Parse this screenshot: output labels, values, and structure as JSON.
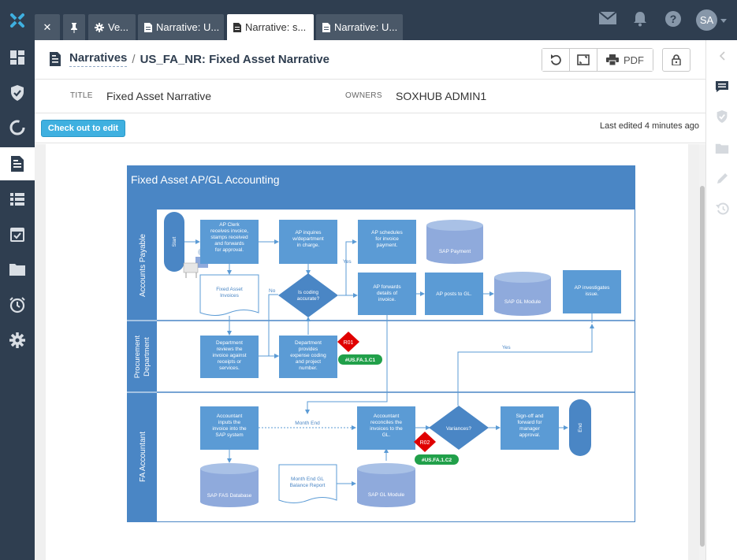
{
  "tabs": [
    {
      "label": "✕",
      "icon": "close-icon"
    },
    {
      "label": "",
      "icon": "pin-icon"
    },
    {
      "label": "Ve...",
      "icon": "gear-icon"
    },
    {
      "label": "Narrative: U...",
      "icon": "document-icon"
    },
    {
      "label": "Narrative: s...",
      "icon": "document-icon",
      "active": true
    },
    {
      "label": "Narrative: U...",
      "icon": "document-icon"
    }
  ],
  "user": {
    "initials": "SA"
  },
  "breadcrumb": {
    "root": "Narratives",
    "separator": "/",
    "current": "US_FA_NR: Fixed Asset Narrative"
  },
  "toolbar": {
    "pdf_label": "PDF"
  },
  "meta": {
    "title_label": "TITLE",
    "title_value": "Fixed Asset Narrative",
    "owners_label": "OWNERS",
    "owners_value": "SOXHUB ADMIN1"
  },
  "action": {
    "checkout_label": "Check out to edit",
    "last_edited": "Last edited 4 minutes ago"
  },
  "diagram": {
    "title": "Fixed Asset AP/GL Accounting",
    "lanes": [
      "Accounts Payable",
      "Procurement Department",
      "FA Accountant"
    ],
    "nodes": {
      "start": "Start",
      "ap_clerk": [
        "AP Clerk",
        "receives invoice,",
        "stamps received",
        "and forwards",
        "for approval."
      ],
      "ap_inquires": [
        "AP inquires",
        "w/department",
        "in charge."
      ],
      "ap_schedules": [
        "AP schedules",
        "for invoice",
        "payment."
      ],
      "sap_payment": "SAP Payment",
      "fixed_asset_invoices": [
        "Fixed Asset",
        "Invoices"
      ],
      "coding_accurate": [
        "Is coding",
        "accurate?"
      ],
      "ap_forwards": [
        "AP forwards",
        "details of",
        "invoice."
      ],
      "ap_posts": "AP posts to GL.",
      "sap_gl_module": "SAP GL Module",
      "ap_investigates": [
        "AP investigates",
        "issue."
      ],
      "dept_reviews": [
        "Department",
        "reviews the",
        "invoice against",
        "receipts or",
        "services."
      ],
      "dept_provides": [
        "Department",
        "provides",
        "expense coding",
        "and project",
        "number."
      ],
      "risk1": "R01",
      "control1": "#US.FA.1.C1",
      "accountant_inputs": [
        "Accountant",
        "inputs the",
        "invoice into the",
        "SAP system"
      ],
      "accountant_reconciles": [
        "Accountant",
        "reconciles the",
        "invoices to the",
        "GL."
      ],
      "variances": "Variances?",
      "signoff": [
        "Sign-off and",
        "forward for",
        "manager",
        "approval."
      ],
      "end": "End",
      "sap_fas_db": "SAP FAS Database",
      "month_end_report": [
        "Month End GL",
        "Balance Report"
      ],
      "sap_gl_module2": "SAP GL Module",
      "risk2": "R02",
      "control2": "#US.FA.1.C2",
      "yes1": "Yes",
      "no1": "No",
      "yes2": "Yes",
      "month_end": "Month End"
    }
  },
  "colors": {
    "nav_bg": "#2f3e50",
    "accent": "#3fb0e0",
    "diagram_header": "#4a86c5",
    "shape_fill": "#5b9bd5",
    "cylinder_fill": "#8faadc",
    "lane_fill": "#4a86c5",
    "risk_red": "#e00000",
    "control_green": "#21a04a"
  }
}
